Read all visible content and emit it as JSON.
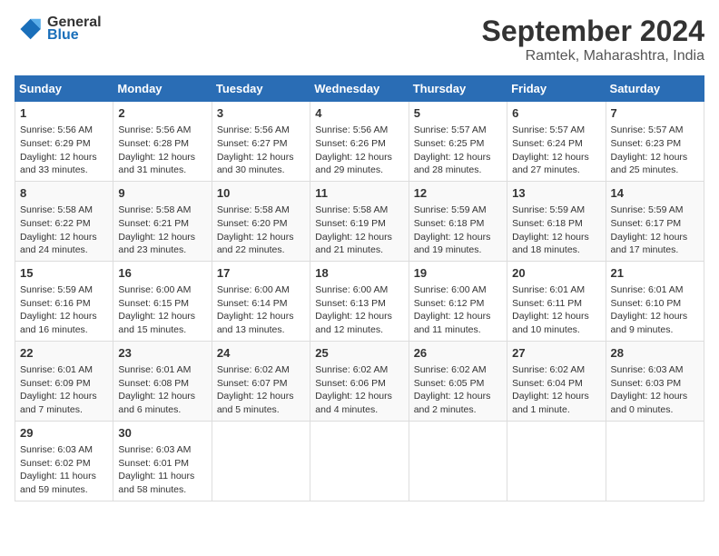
{
  "header": {
    "logo_line1": "General",
    "logo_line2": "Blue",
    "month": "September 2024",
    "location": "Ramtek, Maharashtra, India"
  },
  "days_of_week": [
    "Sunday",
    "Monday",
    "Tuesday",
    "Wednesday",
    "Thursday",
    "Friday",
    "Saturday"
  ],
  "weeks": [
    [
      {
        "day": "1",
        "sunrise": "Sunrise: 5:56 AM",
        "sunset": "Sunset: 6:29 PM",
        "daylight": "Daylight: 12 hours and 33 minutes."
      },
      {
        "day": "2",
        "sunrise": "Sunrise: 5:56 AM",
        "sunset": "Sunset: 6:28 PM",
        "daylight": "Daylight: 12 hours and 31 minutes."
      },
      {
        "day": "3",
        "sunrise": "Sunrise: 5:56 AM",
        "sunset": "Sunset: 6:27 PM",
        "daylight": "Daylight: 12 hours and 30 minutes."
      },
      {
        "day": "4",
        "sunrise": "Sunrise: 5:56 AM",
        "sunset": "Sunset: 6:26 PM",
        "daylight": "Daylight: 12 hours and 29 minutes."
      },
      {
        "day": "5",
        "sunrise": "Sunrise: 5:57 AM",
        "sunset": "Sunset: 6:25 PM",
        "daylight": "Daylight: 12 hours and 28 minutes."
      },
      {
        "day": "6",
        "sunrise": "Sunrise: 5:57 AM",
        "sunset": "Sunset: 6:24 PM",
        "daylight": "Daylight: 12 hours and 27 minutes."
      },
      {
        "day": "7",
        "sunrise": "Sunrise: 5:57 AM",
        "sunset": "Sunset: 6:23 PM",
        "daylight": "Daylight: 12 hours and 25 minutes."
      }
    ],
    [
      {
        "day": "8",
        "sunrise": "Sunrise: 5:58 AM",
        "sunset": "Sunset: 6:22 PM",
        "daylight": "Daylight: 12 hours and 24 minutes."
      },
      {
        "day": "9",
        "sunrise": "Sunrise: 5:58 AM",
        "sunset": "Sunset: 6:21 PM",
        "daylight": "Daylight: 12 hours and 23 minutes."
      },
      {
        "day": "10",
        "sunrise": "Sunrise: 5:58 AM",
        "sunset": "Sunset: 6:20 PM",
        "daylight": "Daylight: 12 hours and 22 minutes."
      },
      {
        "day": "11",
        "sunrise": "Sunrise: 5:58 AM",
        "sunset": "Sunset: 6:19 PM",
        "daylight": "Daylight: 12 hours and 21 minutes."
      },
      {
        "day": "12",
        "sunrise": "Sunrise: 5:59 AM",
        "sunset": "Sunset: 6:18 PM",
        "daylight": "Daylight: 12 hours and 19 minutes."
      },
      {
        "day": "13",
        "sunrise": "Sunrise: 5:59 AM",
        "sunset": "Sunset: 6:18 PM",
        "daylight": "Daylight: 12 hours and 18 minutes."
      },
      {
        "day": "14",
        "sunrise": "Sunrise: 5:59 AM",
        "sunset": "Sunset: 6:17 PM",
        "daylight": "Daylight: 12 hours and 17 minutes."
      }
    ],
    [
      {
        "day": "15",
        "sunrise": "Sunrise: 5:59 AM",
        "sunset": "Sunset: 6:16 PM",
        "daylight": "Daylight: 12 hours and 16 minutes."
      },
      {
        "day": "16",
        "sunrise": "Sunrise: 6:00 AM",
        "sunset": "Sunset: 6:15 PM",
        "daylight": "Daylight: 12 hours and 15 minutes."
      },
      {
        "day": "17",
        "sunrise": "Sunrise: 6:00 AM",
        "sunset": "Sunset: 6:14 PM",
        "daylight": "Daylight: 12 hours and 13 minutes."
      },
      {
        "day": "18",
        "sunrise": "Sunrise: 6:00 AM",
        "sunset": "Sunset: 6:13 PM",
        "daylight": "Daylight: 12 hours and 12 minutes."
      },
      {
        "day": "19",
        "sunrise": "Sunrise: 6:00 AM",
        "sunset": "Sunset: 6:12 PM",
        "daylight": "Daylight: 12 hours and 11 minutes."
      },
      {
        "day": "20",
        "sunrise": "Sunrise: 6:01 AM",
        "sunset": "Sunset: 6:11 PM",
        "daylight": "Daylight: 12 hours and 10 minutes."
      },
      {
        "day": "21",
        "sunrise": "Sunrise: 6:01 AM",
        "sunset": "Sunset: 6:10 PM",
        "daylight": "Daylight: 12 hours and 9 minutes."
      }
    ],
    [
      {
        "day": "22",
        "sunrise": "Sunrise: 6:01 AM",
        "sunset": "Sunset: 6:09 PM",
        "daylight": "Daylight: 12 hours and 7 minutes."
      },
      {
        "day": "23",
        "sunrise": "Sunrise: 6:01 AM",
        "sunset": "Sunset: 6:08 PM",
        "daylight": "Daylight: 12 hours and 6 minutes."
      },
      {
        "day": "24",
        "sunrise": "Sunrise: 6:02 AM",
        "sunset": "Sunset: 6:07 PM",
        "daylight": "Daylight: 12 hours and 5 minutes."
      },
      {
        "day": "25",
        "sunrise": "Sunrise: 6:02 AM",
        "sunset": "Sunset: 6:06 PM",
        "daylight": "Daylight: 12 hours and 4 minutes."
      },
      {
        "day": "26",
        "sunrise": "Sunrise: 6:02 AM",
        "sunset": "Sunset: 6:05 PM",
        "daylight": "Daylight: 12 hours and 2 minutes."
      },
      {
        "day": "27",
        "sunrise": "Sunrise: 6:02 AM",
        "sunset": "Sunset: 6:04 PM",
        "daylight": "Daylight: 12 hours and 1 minute."
      },
      {
        "day": "28",
        "sunrise": "Sunrise: 6:03 AM",
        "sunset": "Sunset: 6:03 PM",
        "daylight": "Daylight: 12 hours and 0 minutes."
      }
    ],
    [
      {
        "day": "29",
        "sunrise": "Sunrise: 6:03 AM",
        "sunset": "Sunset: 6:02 PM",
        "daylight": "Daylight: 11 hours and 59 minutes."
      },
      {
        "day": "30",
        "sunrise": "Sunrise: 6:03 AM",
        "sunset": "Sunset: 6:01 PM",
        "daylight": "Daylight: 11 hours and 58 minutes."
      },
      null,
      null,
      null,
      null,
      null
    ]
  ]
}
